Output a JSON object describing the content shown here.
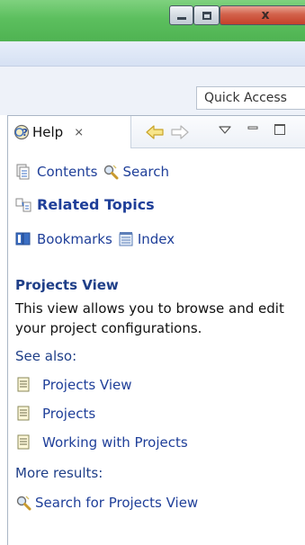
{
  "window": {
    "controls": [
      "minimize",
      "maximize",
      "close"
    ],
    "close_glyph": "x"
  },
  "toolbar": {
    "quick_access": "Quick Access"
  },
  "help_view": {
    "tab_label": "Help",
    "tab_close_glyph": "⨯",
    "nav": {
      "back_icon": "arrow-left-icon",
      "forward_icon": "arrow-right-icon",
      "menu_icon": "view-menu-icon",
      "minimize_icon": "minimize-icon",
      "maximize_icon": "maximize-icon"
    },
    "links": {
      "contents": "Contents",
      "search": "Search",
      "related_topics": "Related Topics",
      "bookmarks": "Bookmarks",
      "index": "Index"
    },
    "topic": {
      "title": "Projects View",
      "description": "This view allows you to browse and edit your project configurations.",
      "see_also_label": "See also:",
      "see_also": [
        "Projects View",
        "Projects",
        "Working with Projects"
      ],
      "more_results_label": "More results:",
      "more_results": [
        "Search for Projects View"
      ]
    }
  },
  "colors": {
    "title_bar": "#5cbf5e",
    "link": "#1f3f99",
    "heading": "#1f3f88",
    "close_button": "#c5412a"
  }
}
